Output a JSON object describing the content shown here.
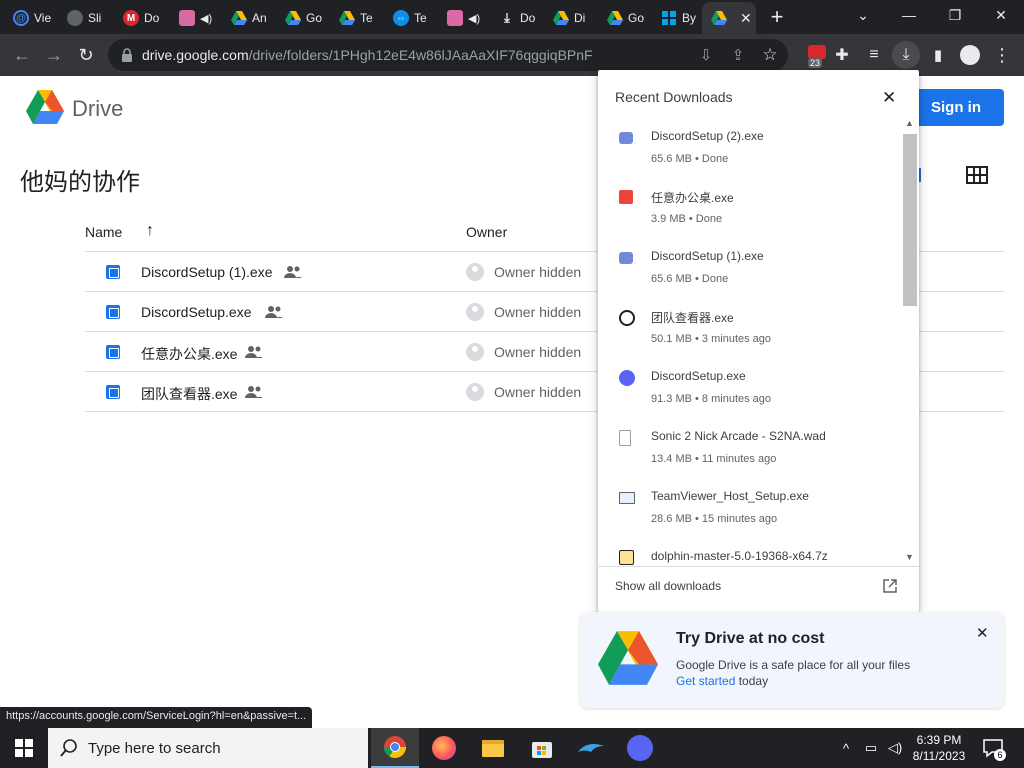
{
  "browser": {
    "tabs": [
      {
        "title": "Vie",
        "favicon": "at-sign-icon",
        "color": "#4285f4"
      },
      {
        "title": "Sli",
        "favicon": "globe-icon",
        "color": "#9aa0a6"
      },
      {
        "title": "Do",
        "favicon": "mega-icon",
        "color": "#d9272e"
      },
      {
        "title": "",
        "favicon": "avatar-icon",
        "color": "#d86aa6"
      },
      {
        "title": "An",
        "favicon": "drive-icon",
        "color": "#34a853"
      },
      {
        "title": "Go",
        "favicon": "drive-icon",
        "color": "#34a853"
      },
      {
        "title": "Te",
        "favicon": "drive-icon",
        "color": "#34a853"
      },
      {
        "title": "Te",
        "favicon": "teamviewer-icon",
        "color": "#0e8ee9"
      },
      {
        "title": "",
        "favicon": "avatar-icon",
        "color": "#d86aa6"
      },
      {
        "title": "Do",
        "favicon": "download-icon",
        "color": "#e8eaed"
      },
      {
        "title": "Di",
        "favicon": "drive-icon",
        "color": "#34a853"
      },
      {
        "title": "Go",
        "favicon": "drive-icon",
        "color": "#34a853"
      },
      {
        "title": "By",
        "favicon": "windows-icon",
        "color": "#00a4ef"
      }
    ],
    "active_tab_close": "✕",
    "url_host": "drive.google.com",
    "url_path": "/drive/folders/1PHgh12eE4w86lJAaAaXIF76qggiqBPnF",
    "ext_badge_count": "23"
  },
  "drive": {
    "brand": "Drive",
    "signin_label": "Sign in",
    "folder_title": "他妈的协作",
    "columns": {
      "name": "Name",
      "owner": "Owner"
    },
    "files": [
      {
        "name": "DiscordSetup (1).exe",
        "owner": "Owner hidden"
      },
      {
        "name": "DiscordSetup.exe",
        "owner": "Owner hidden"
      },
      {
        "name": "任意办公桌.exe",
        "owner": "Owner hidden"
      },
      {
        "name": "团队查看器.exe",
        "owner": "Owner hidden"
      }
    ]
  },
  "downloads": {
    "title": "Recent Downloads",
    "items": [
      {
        "name": "DiscordSetup (2).exe",
        "meta": "65.6 MB • Done",
        "icon": "discord-icon"
      },
      {
        "name": "任意办公桌.exe",
        "meta": "3.9 MB • Done",
        "icon": "anydesk-icon"
      },
      {
        "name": "DiscordSetup (1).exe",
        "meta": "65.6 MB • Done",
        "icon": "discord-icon"
      },
      {
        "name": "团队查看器.exe",
        "meta": "50.1 MB • 3 minutes ago",
        "icon": "teamviewer-icon"
      },
      {
        "name": "DiscordSetup.exe",
        "meta": "91.3 MB • 8 minutes ago",
        "icon": "discord-icon"
      },
      {
        "name": "Sonic 2 Nick Arcade - S2NA.wad",
        "meta": "13.4 MB • 11 minutes ago",
        "icon": "file-icon"
      },
      {
        "name": "TeamViewer_Host_Setup.exe",
        "meta": "28.6 MB • 15 minutes ago",
        "icon": "installer-icon"
      },
      {
        "name": "dolphin-master-5.0-19368-x64.7z",
        "meta": "",
        "icon": "archive-icon"
      }
    ],
    "show_all": "Show all downloads"
  },
  "promo": {
    "title": "Try Drive at no cost",
    "text": "Google Drive is a safe place for all your files",
    "link": "Get started",
    "text_after": " today"
  },
  "status_url": "https://accounts.google.com/ServiceLogin?hl=en&passive=t...",
  "taskbar": {
    "search_placeholder": "Type here to search",
    "time": "6:39 PM",
    "date": "8/11/2023",
    "notification_count": "6"
  },
  "colors": {
    "accent": "#1a73e8",
    "chrome_dark": "#202124",
    "toolbar": "#35363a"
  }
}
